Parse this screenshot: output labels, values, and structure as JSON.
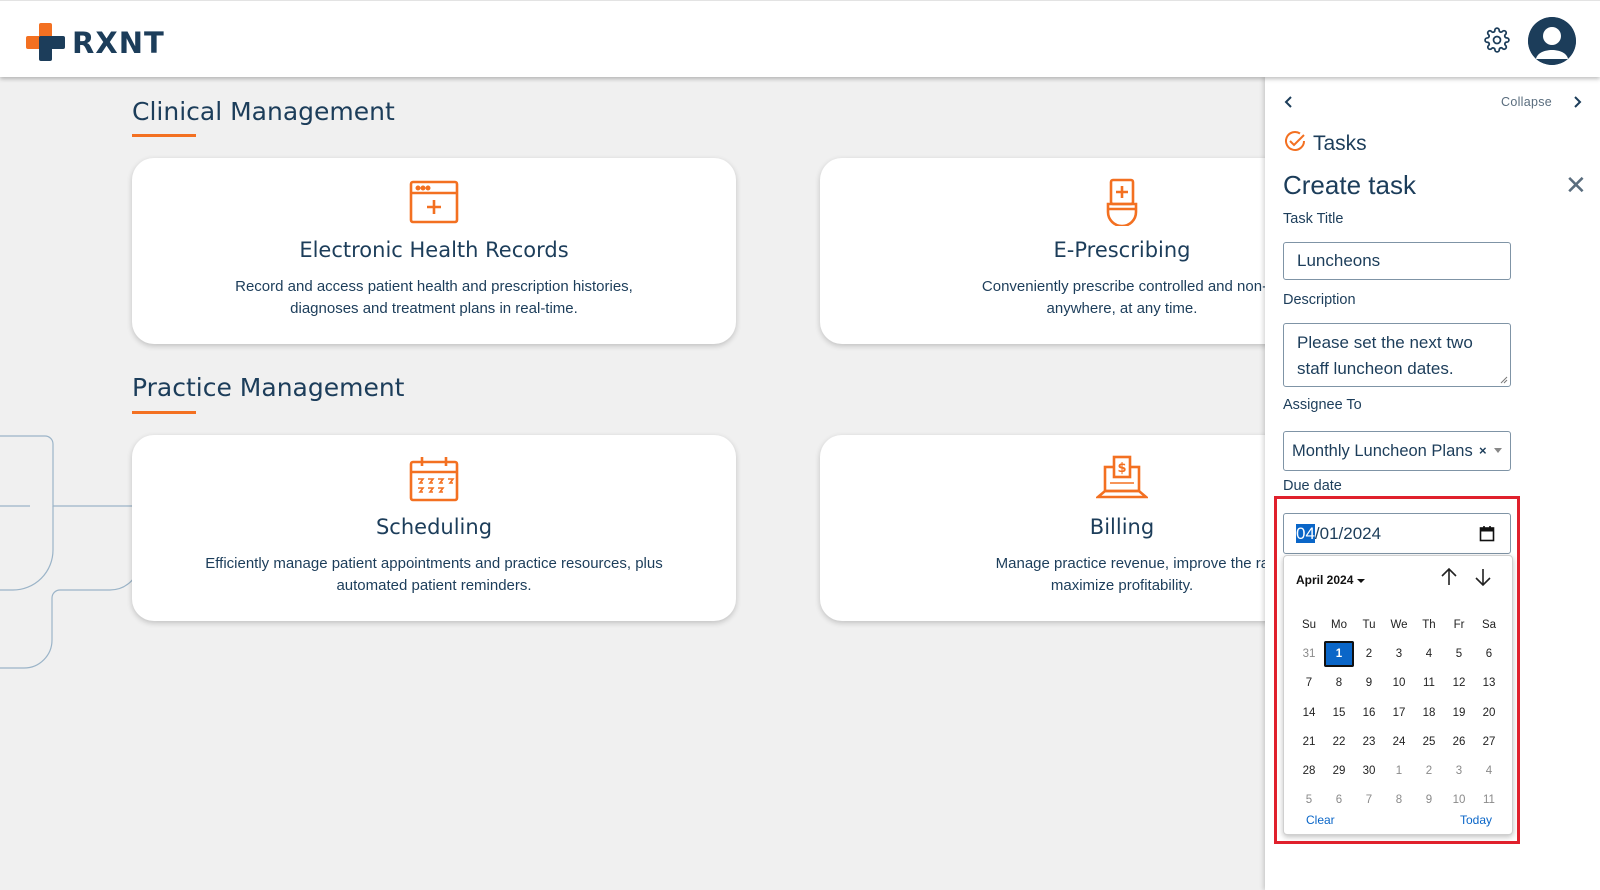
{
  "header": {
    "logo_text": "RXNT",
    "settings_icon": "gear-icon",
    "avatar_icon": "user-avatar-icon"
  },
  "colors": {
    "brand_orange": "#f37021",
    "brand_navy": "#1c3d5a",
    "accent_blue": "#0a66c8",
    "highlight_red": "#e0202c"
  },
  "sections": {
    "clinical": {
      "title": "Clinical Management",
      "cards": [
        {
          "title": "Electronic Health Records",
          "desc_line1": "Record and access patient health and prescription histories,",
          "desc_line2": "diagnoses and treatment plans in real-time.",
          "icon": "ehr-calendar-plus-icon"
        },
        {
          "title": "E-Prescribing",
          "desc_line1": "Conveniently prescribe controlled and non-controlled su",
          "desc_line2": "anywhere, at any time.",
          "icon": "prescription-bottle-icon"
        }
      ]
    },
    "practice": {
      "title": "Practice Management",
      "cards": [
        {
          "title": "Scheduling",
          "desc_line1": "Efficiently manage patient appointments and practice resources, plus",
          "desc_line2": "automated patient reminders.",
          "icon": "calendar-icon"
        },
        {
          "title": "Billing",
          "desc_line1": "Manage practice revenue, improve the rate of reimbu",
          "desc_line2": "maximize profitability.",
          "icon": "billing-laptop-icon"
        }
      ]
    }
  },
  "panel": {
    "collapse_label": "Collapse",
    "tasks_label": "Tasks",
    "create_title": "Create task",
    "close_symbol": "✕",
    "task_title_label": "Task Title",
    "task_title_value": "Luncheons",
    "description_label": "Description",
    "description_line1": "Please set the next two",
    "description_line2": "staff luncheon dates.",
    "assignee_label": "Assignee To",
    "assignee_value": "Monthly Luncheon Plans",
    "assignee_clear": "×",
    "due_date_label": "Due date",
    "due_date_month_part": "04",
    "due_date_rest": "/01/2024"
  },
  "calendar": {
    "month_label": "April 2024",
    "weekdays": [
      "Su",
      "Mo",
      "Tu",
      "We",
      "Th",
      "Fr",
      "Sa"
    ],
    "weeks": [
      [
        {
          "d": "31",
          "m": true
        },
        {
          "d": "1",
          "sel": true
        },
        {
          "d": "2"
        },
        {
          "d": "3"
        },
        {
          "d": "4"
        },
        {
          "d": "5"
        },
        {
          "d": "6"
        }
      ],
      [
        {
          "d": "7"
        },
        {
          "d": "8"
        },
        {
          "d": "9"
        },
        {
          "d": "10"
        },
        {
          "d": "11"
        },
        {
          "d": "12"
        },
        {
          "d": "13"
        }
      ],
      [
        {
          "d": "14"
        },
        {
          "d": "15"
        },
        {
          "d": "16"
        },
        {
          "d": "17"
        },
        {
          "d": "18"
        },
        {
          "d": "19"
        },
        {
          "d": "20"
        }
      ],
      [
        {
          "d": "21"
        },
        {
          "d": "22"
        },
        {
          "d": "23"
        },
        {
          "d": "24"
        },
        {
          "d": "25"
        },
        {
          "d": "26"
        },
        {
          "d": "27"
        }
      ],
      [
        {
          "d": "28"
        },
        {
          "d": "29"
        },
        {
          "d": "30"
        },
        {
          "d": "1",
          "m": true
        },
        {
          "d": "2",
          "m": true
        },
        {
          "d": "3",
          "m": true
        },
        {
          "d": "4",
          "m": true
        }
      ],
      [
        {
          "d": "5",
          "m": true
        },
        {
          "d": "6",
          "m": true
        },
        {
          "d": "7",
          "m": true
        },
        {
          "d": "8",
          "m": true
        },
        {
          "d": "9",
          "m": true
        },
        {
          "d": "10",
          "m": true
        },
        {
          "d": "11",
          "m": true
        }
      ]
    ],
    "clear_label": "Clear",
    "today_label": "Today"
  }
}
